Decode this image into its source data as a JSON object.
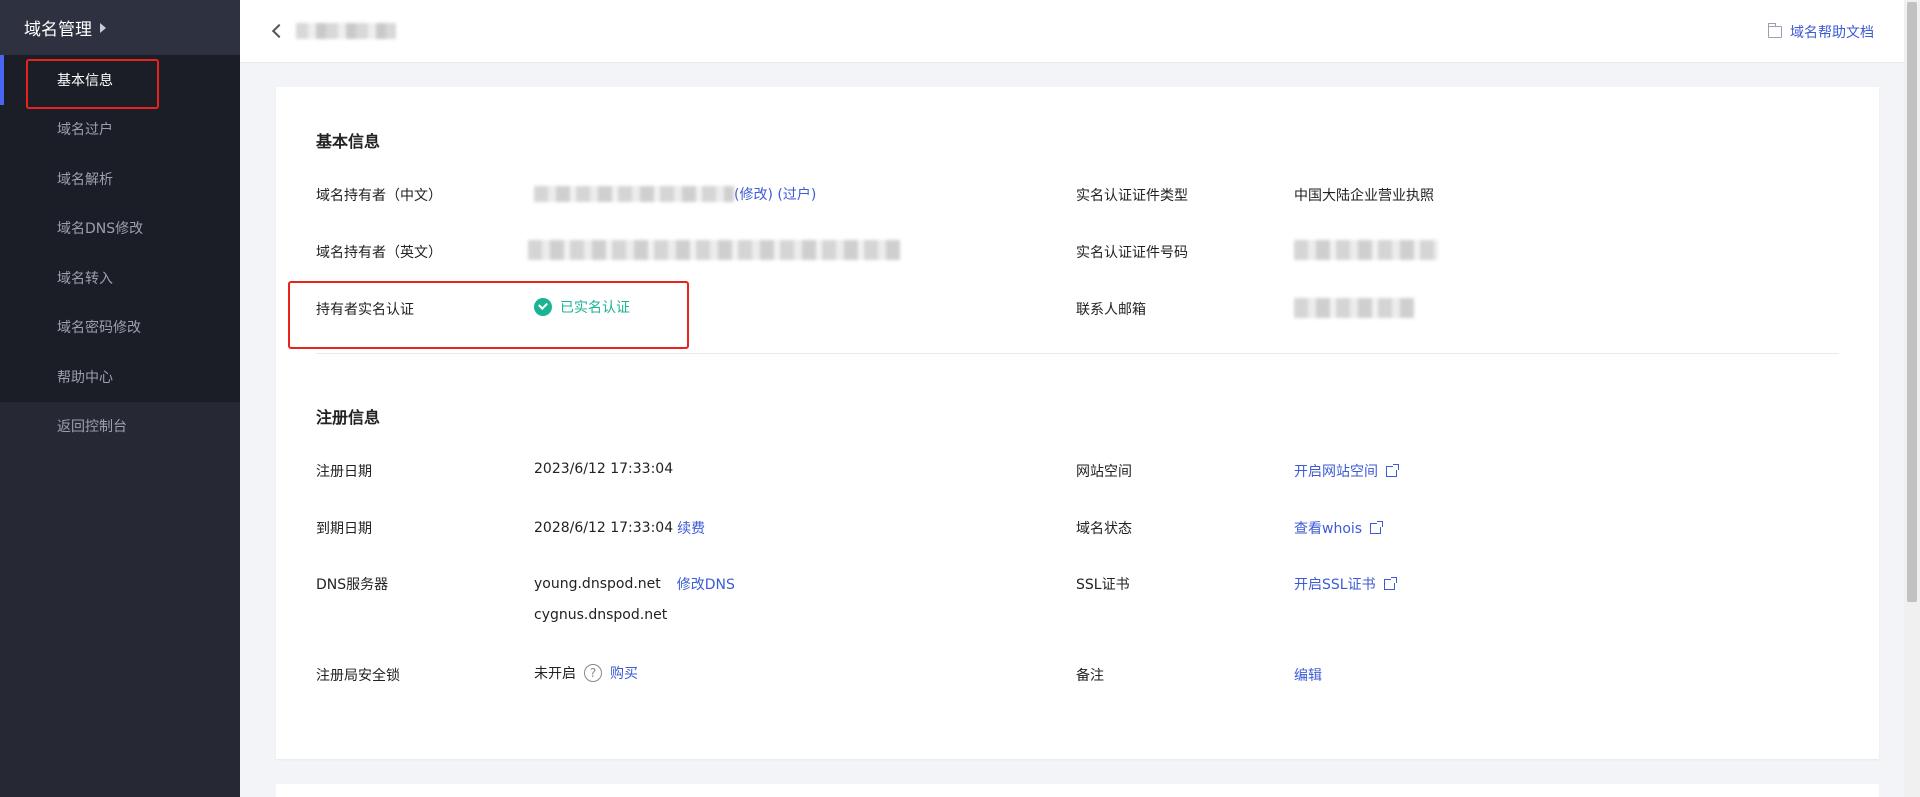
{
  "sidebar": {
    "title": "域名管理",
    "items": [
      {
        "label": "基本信息",
        "active": true
      },
      {
        "label": "域名过户"
      },
      {
        "label": "域名解析"
      },
      {
        "label": "域名DNS修改"
      },
      {
        "label": "域名转入"
      },
      {
        "label": "域名密码修改"
      },
      {
        "label": "帮助中心"
      }
    ],
    "back_label": "返回控制台"
  },
  "topbar": {
    "help_doc_label": "域名帮助文档"
  },
  "basic_info": {
    "title": "基本信息",
    "owner_cn_label": "域名持有者（中文）",
    "owner_cn_links": "(修改) (过户)",
    "owner_en_label": "域名持有者（英文）",
    "realname_label": "持有者实名认证",
    "realname_status": "已实名认证",
    "cert_type_label": "实名认证证件类型",
    "cert_type_value": "中国大陆企业营业执照",
    "cert_no_label": "实名认证证件号码",
    "email_label": "联系人邮箱"
  },
  "reg_info": {
    "title": "注册信息",
    "reg_date_label": "注册日期",
    "reg_date_value": "2023/6/12 17:33:04",
    "exp_date_label": "到期日期",
    "exp_date_value": "2028/6/12 17:33:04",
    "renew_link": "续费",
    "dns_label": "DNS服务器",
    "dns_1": "young.dnspod.net",
    "dns_2": "cygnus.dnspod.net",
    "dns_modify_link": "修改DNS",
    "lock_label": "注册局安全锁",
    "lock_value": "未开启",
    "lock_buy_link": "购买",
    "website_label": "网站空间",
    "website_link": "开启网站空间",
    "status_label": "域名状态",
    "status_link": "查看whois",
    "ssl_label": "SSL证书",
    "ssl_link": "开启SSL证书",
    "note_label": "备注",
    "note_link": "编辑"
  },
  "colors": {
    "accent": "#3d5bd6",
    "success": "#1bb394",
    "highlight": "#e8231e",
    "sidebar_bg": "#262934"
  }
}
